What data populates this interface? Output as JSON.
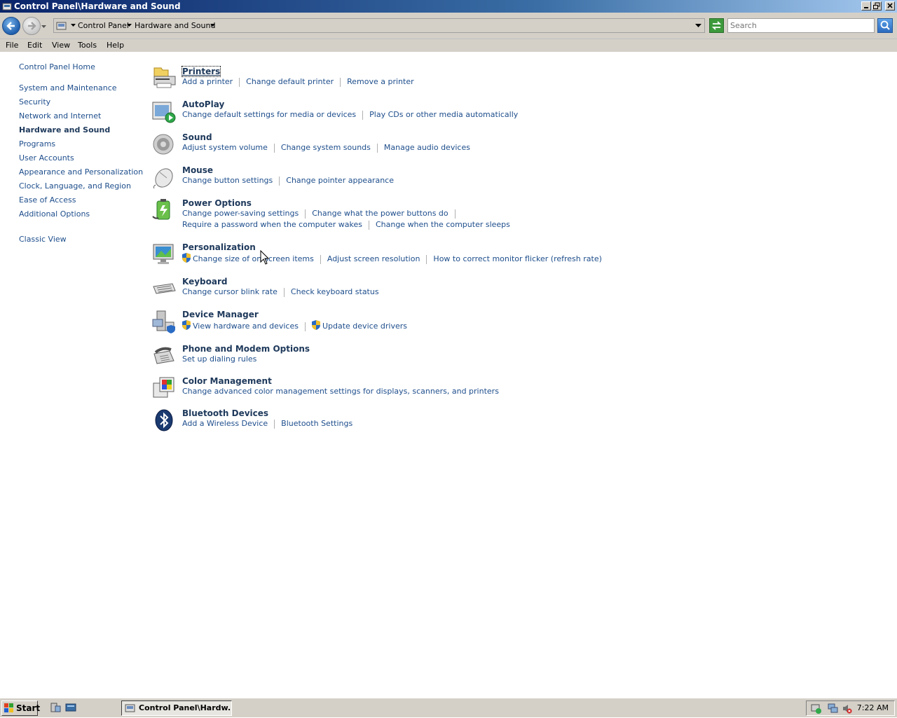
{
  "window": {
    "title": "Control Panel\\Hardware and Sound"
  },
  "address": {
    "crumbs": [
      "Control Panel",
      "Hardware and Sound"
    ],
    "search_placeholder": "Search"
  },
  "menu": [
    "File",
    "Edit",
    "View",
    "Tools",
    "Help"
  ],
  "leftnav": {
    "home": "Control Panel Home",
    "items": [
      "System and Maintenance",
      "Security",
      "Network and Internet",
      "Hardware and Sound",
      "Programs",
      "User Accounts",
      "Appearance and Personalization",
      "Clock, Language, and Region",
      "Ease of Access",
      "Additional Options"
    ],
    "current": "Hardware and Sound",
    "classic": "Classic View"
  },
  "categories": [
    {
      "title": "Printers",
      "icon": "printer-icon",
      "lines": [
        [
          "Add a printer",
          "Change default printer",
          "Remove a printer"
        ]
      ]
    },
    {
      "title": "AutoPlay",
      "icon": "autoplay-icon",
      "lines": [
        [
          "Change default settings for media or devices",
          "Play CDs or other media automatically"
        ]
      ]
    },
    {
      "title": "Sound",
      "icon": "speaker-icon",
      "lines": [
        [
          "Adjust system volume",
          "Change system sounds",
          "Manage audio devices"
        ]
      ]
    },
    {
      "title": "Mouse",
      "icon": "mouse-icon",
      "lines": [
        [
          "Change button settings",
          "Change pointer appearance"
        ]
      ]
    },
    {
      "title": "Power Options",
      "icon": "battery-icon",
      "lines": [
        [
          "Change power-saving settings",
          "Change what the power buttons do"
        ],
        [
          "Require a password when the computer wakes",
          "Change when the computer sleeps"
        ]
      ]
    },
    {
      "title": "Personalization",
      "icon": "monitor-icon",
      "lines": [
        [
          "Change size of on-screen items",
          "Adjust screen resolution",
          "How to correct monitor flicker (refresh rate)"
        ]
      ]
    },
    {
      "title": "Keyboard",
      "icon": "keyboard-icon",
      "lines": [
        [
          "Change cursor blink rate",
          "Check keyboard status"
        ]
      ]
    },
    {
      "title": "Device Manager",
      "icon": "device-manager-icon",
      "lines": [
        [
          "View hardware and devices",
          "Update device drivers"
        ]
      ]
    },
    {
      "title": "Phone and Modem Options",
      "icon": "phone-icon",
      "lines": [
        [
          "Set up dialing rules"
        ]
      ]
    },
    {
      "title": "Color Management",
      "icon": "color-management-icon",
      "lines": [
        [
          "Change advanced color management settings for displays, scanners, and printers"
        ]
      ]
    },
    {
      "title": "Bluetooth Devices",
      "icon": "bluetooth-icon",
      "lines": [
        [
          "Add a Wireless Device",
          "Bluetooth Settings"
        ]
      ]
    }
  ],
  "taskbar": {
    "start": "Start",
    "task": "Control Panel\\Hardw...",
    "clock": "7:22 AM"
  }
}
